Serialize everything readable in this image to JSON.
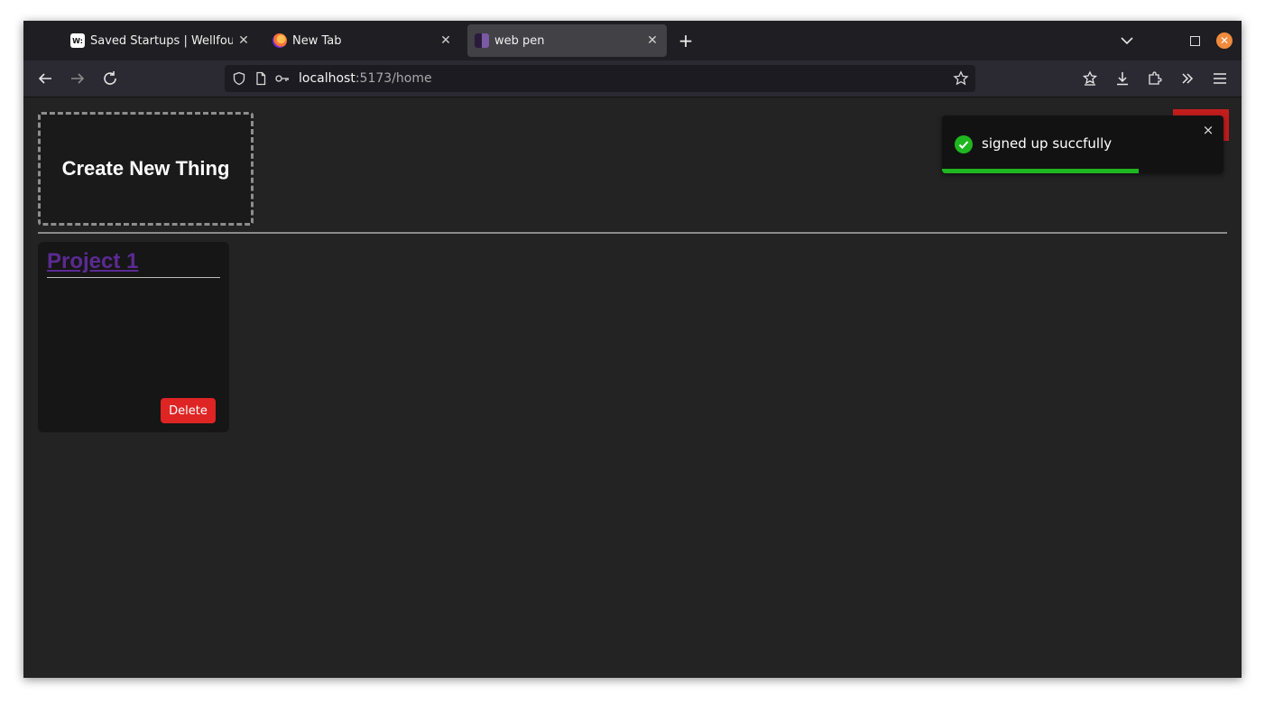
{
  "browser": {
    "tabs": [
      {
        "title": "Saved Startups | Wellfound",
        "favicon": "wellfound-favicon",
        "active": false
      },
      {
        "title": "New Tab",
        "favicon": "firefox-favicon",
        "active": false
      },
      {
        "title": "web pen",
        "favicon": "webpen-favicon",
        "active": true
      }
    ],
    "new_tab_label": "+",
    "url": {
      "host": "localhost",
      "rest": ":5173/home"
    }
  },
  "page": {
    "create_label": "Create New Thing",
    "projects": [
      {
        "title": "Project 1",
        "delete_label": "Delete"
      }
    ]
  },
  "toast": {
    "message": "signed up succfully",
    "close_glyph": "×",
    "progress": 0.7,
    "type": "success",
    "color": "#1fb71f"
  },
  "colors": {
    "delete": "#df2424",
    "project_link": "#5b2a92",
    "background": "#232323"
  }
}
